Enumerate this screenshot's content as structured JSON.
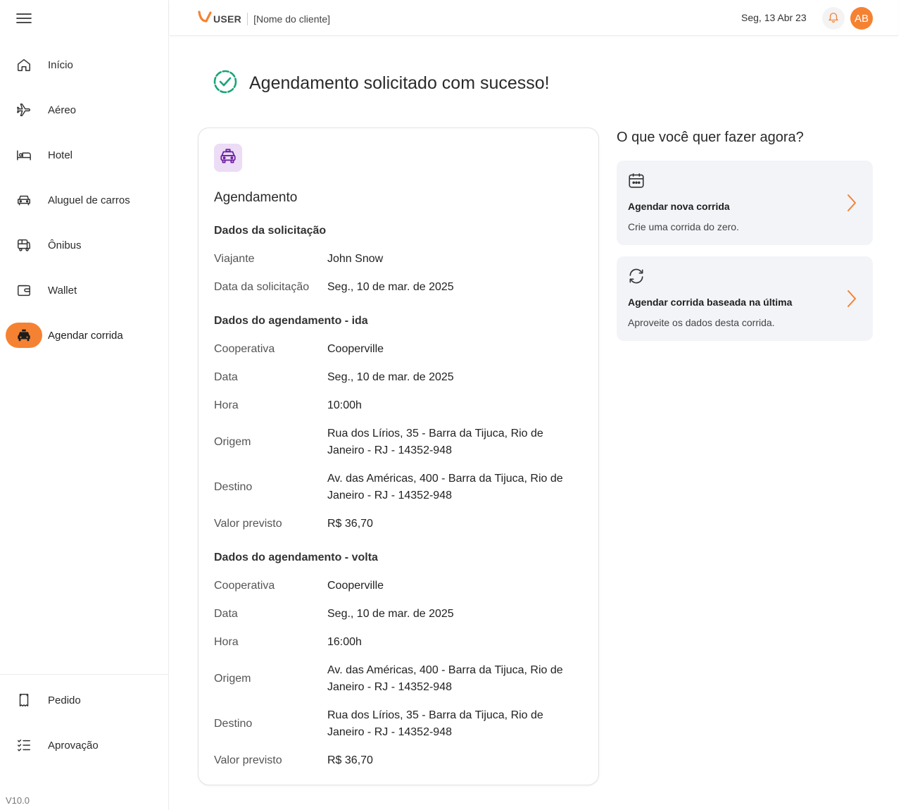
{
  "sidebar": {
    "menu_icon": "hamburger-icon",
    "items": [
      {
        "label": "Início",
        "icon": "home-icon"
      },
      {
        "label": "Aéreo",
        "icon": "plane-icon"
      },
      {
        "label": "Hotel",
        "icon": "bed-icon"
      },
      {
        "label": "Aluguel de carros",
        "icon": "car-icon"
      },
      {
        "label": "Ônibus",
        "icon": "bus-icon"
      },
      {
        "label": "Wallet",
        "icon": "wallet-icon"
      },
      {
        "label": "Agendar corrida",
        "icon": "taxi-icon",
        "active": true
      }
    ],
    "bottom_items": [
      {
        "label": "Pedido",
        "icon": "receipt-icon"
      },
      {
        "label": "Aprovação",
        "icon": "checklist-icon"
      }
    ],
    "version": "V10.0"
  },
  "header": {
    "logo_text": "USER",
    "client_name": "[Nome do cliente]",
    "date": "Seg, 13 Abr 23",
    "avatar_initials": "AB"
  },
  "success": {
    "title": "Agendamento solicitado com sucesso!"
  },
  "card": {
    "title": "Agendamento",
    "request": {
      "title": "Dados da solicitação",
      "rows": [
        {
          "label": "Viajante",
          "value": "John Snow"
        },
        {
          "label": "Data da solicitação",
          "value": "Seg., 10 de mar. de 2025"
        }
      ]
    },
    "outbound": {
      "title": "Dados do agendamento - ida",
      "rows": [
        {
          "label": "Cooperativa",
          "value": "Cooperville"
        },
        {
          "label": "Data",
          "value": "Seg., 10 de mar. de 2025"
        },
        {
          "label": "Hora",
          "value": "10:00h"
        },
        {
          "label": "Origem",
          "value": "Rua dos Lírios, 35 - Barra da Tijuca, Rio de Janeiro - RJ - 14352-948"
        },
        {
          "label": "Destino",
          "value": "Av. das Américas, 400 - Barra da Tijuca, Rio de Janeiro - RJ - 14352-948"
        },
        {
          "label": "Valor previsto",
          "value": "R$ 36,70"
        }
      ]
    },
    "return": {
      "title": "Dados do agendamento - volta",
      "rows": [
        {
          "label": "Cooperativa",
          "value": "Cooperville"
        },
        {
          "label": "Data",
          "value": "Seg., 10 de mar. de 2025"
        },
        {
          "label": "Hora",
          "value": "16:00h"
        },
        {
          "label": "Origem",
          "value": "Av. das Américas, 400 - Barra da Tijuca, Rio de Janeiro - RJ - 14352-948"
        },
        {
          "label": "Destino",
          "value": "Rua dos Lírios, 35 - Barra da Tijuca, Rio de Janeiro - RJ - 14352-948"
        },
        {
          "label": "Valor previsto",
          "value": "R$ 36,70"
        }
      ]
    }
  },
  "actions": {
    "title": "O que você quer fazer agora?",
    "items": [
      {
        "title": "Agendar nova corrida",
        "description": "Crie uma corrida do zero.",
        "icon": "calendar-icon"
      },
      {
        "title": "Agendar corrida baseada na última",
        "description": "Aproveite os dados desta corrida.",
        "icon": "refresh-icon"
      }
    ]
  },
  "colors": {
    "accent": "#f58232",
    "success": "#1aa37a",
    "taxi_icon": "#6a1fa0",
    "taxi_icon_bg": "#ecdcf6"
  }
}
